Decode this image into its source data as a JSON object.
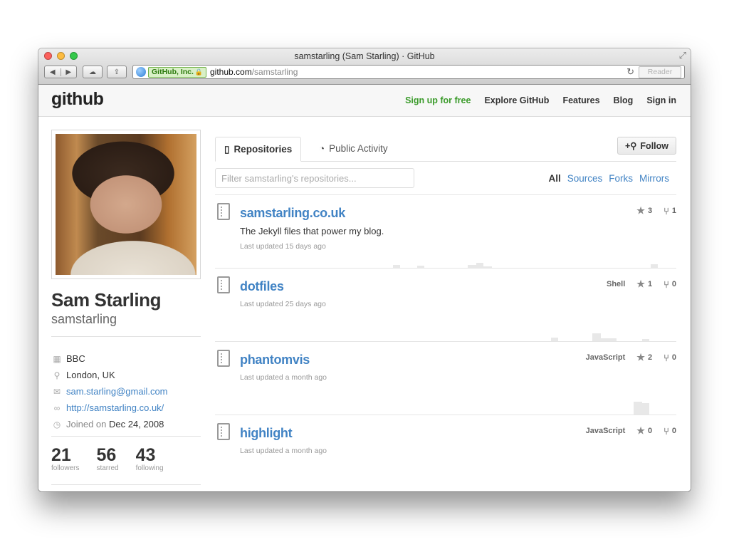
{
  "browser": {
    "window_title": "samstarling (Sam Starling) · GitHub",
    "ev_badge": "GitHub, Inc.",
    "url_host": "github.com",
    "url_path": "/samstarling",
    "reader_label": "Reader"
  },
  "header": {
    "logo": "github",
    "nav": [
      "Sign up for free",
      "Explore GitHub",
      "Features",
      "Blog",
      "Sign in"
    ]
  },
  "profile": {
    "fullname": "Sam Starling",
    "username": "samstarling",
    "company": "BBC",
    "location": "London, UK",
    "email": "sam.starling@gmail.com",
    "website": "http://samstarling.co.uk/",
    "joined_label": "Joined on",
    "joined_date": "Dec 24, 2008",
    "stats": [
      {
        "num": "21",
        "label": "followers"
      },
      {
        "num": "56",
        "label": "starred"
      },
      {
        "num": "43",
        "label": "following"
      }
    ]
  },
  "tabs": {
    "repositories": "Repositories",
    "activity": "Public Activity"
  },
  "follow_label": "Follow",
  "filter": {
    "placeholder": "Filter samstarling's repositories...",
    "options": [
      "All",
      "Sources",
      "Forks",
      "Mirrors"
    ]
  },
  "repos": [
    {
      "name": "samstarling.co.uk",
      "description": "The Jekyll files that power my blog.",
      "updated": "Last updated 15 days ago",
      "language": "",
      "stars": "3",
      "forks": "1"
    },
    {
      "name": "dotfiles",
      "description": "",
      "updated": "Last updated 25 days ago",
      "language": "Shell",
      "stars": "1",
      "forks": "0"
    },
    {
      "name": "phantomvis",
      "description": "",
      "updated": "Last updated a month ago",
      "language": "JavaScript",
      "stars": "2",
      "forks": "0"
    },
    {
      "name": "highlight",
      "description": "",
      "updated": "Last updated a month ago",
      "language": "JavaScript",
      "stars": "0",
      "forks": "0"
    }
  ],
  "colors": {
    "link": "#4183c4",
    "signup": "#3b9b2b",
    "text": "#333333"
  },
  "icons": {
    "company": "building-icon",
    "location": "location-pin-icon",
    "email": "envelope-icon",
    "website": "link-icon",
    "joined": "clock-icon",
    "star": "star-icon",
    "fork": "fork-icon",
    "repo": "repo-book-icon"
  }
}
